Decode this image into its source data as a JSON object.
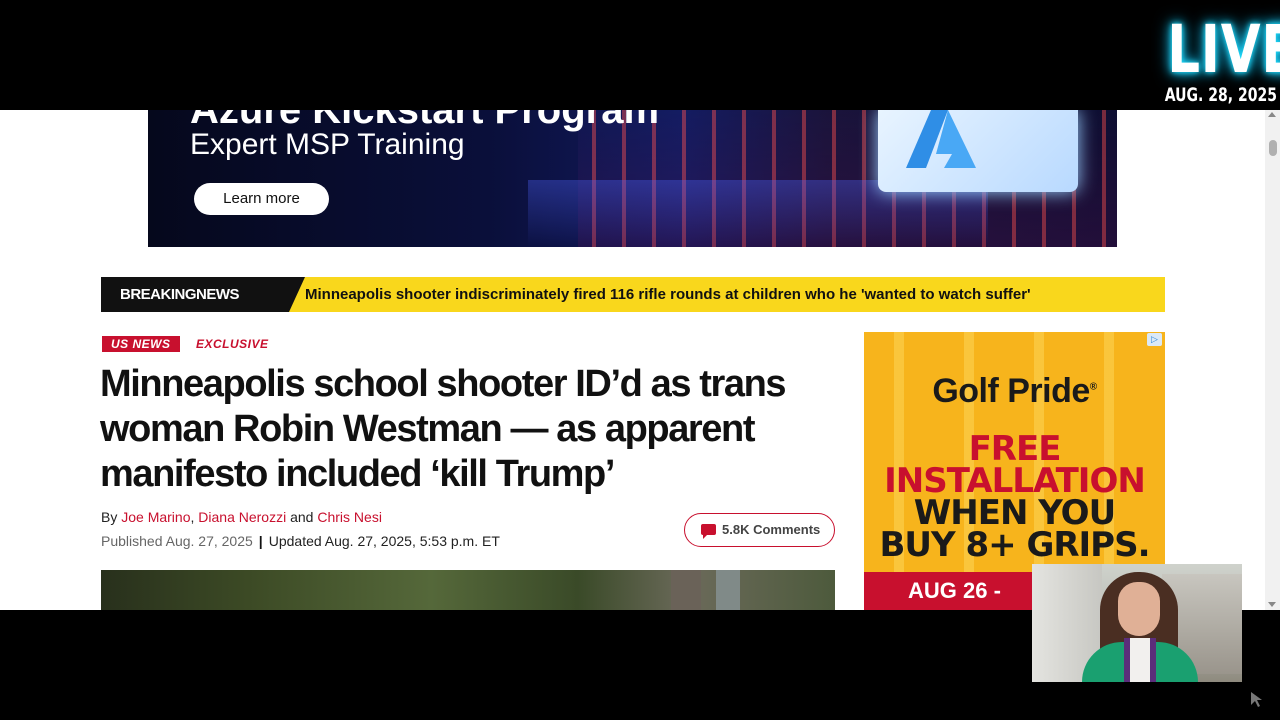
{
  "live_overlay": {
    "live_label": "LIVE",
    "date": "AUG. 28, 2025",
    "glow_color": "#20e0ff"
  },
  "banner_ad": {
    "headline": "Azure Kickstart Program",
    "subline": "Expert MSP Training",
    "cta": "Learn more",
    "icon": "azure-logo-icon"
  },
  "breaking_news": {
    "label": "BREAKINGNEWS",
    "headline": "Minneapolis shooter indiscriminately fired 116 rifle rounds at children who he 'wanted to watch suffer'",
    "bar_color": "#f9d71c"
  },
  "article": {
    "section_tag": "US NEWS",
    "exclusive_tag": "EXCLUSIVE",
    "headline": "Minneapolis school shooter ID’d as trans woman Robin Westman — as apparent manifesto included ‘kill Trump’",
    "byline_prefix": "By",
    "authors": [
      "Joe Marino",
      "Diana Nerozzi",
      "Chris Nesi"
    ],
    "author_sep_1": ",",
    "author_sep_2": "and",
    "published": "Published Aug. 27, 2025",
    "updated": "Updated Aug. 27, 2025, 5:53 p.m. ET",
    "comments_label": "5.8K Comments",
    "accent_color": "#c8102e"
  },
  "side_ad": {
    "brand": "Golf Pride",
    "line1": "FREE",
    "line2": "INSTALLATION",
    "line3": "WHEN YOU",
    "line4": "BUY 8+ GRIPS.",
    "date_strip": "AUG 26 -",
    "adchoices_icon": "adchoices-icon",
    "bg_color": "#f7b41c"
  }
}
